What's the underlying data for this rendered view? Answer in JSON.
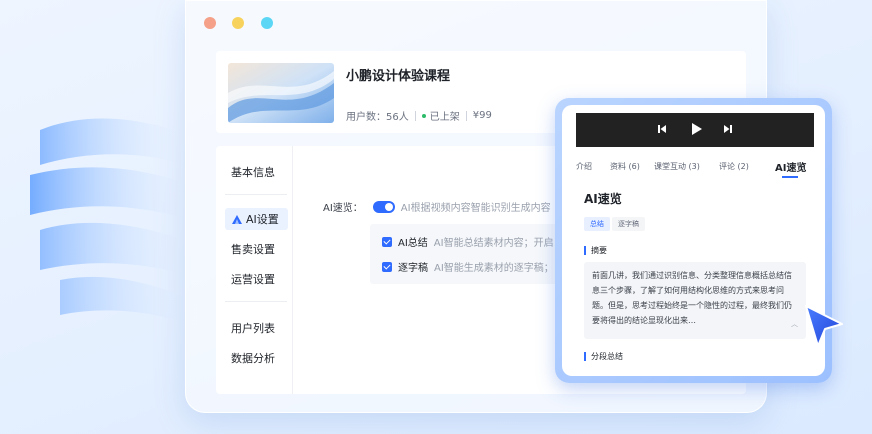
{
  "course": {
    "title": "小鹏设计体验课程",
    "users": "用户数：56人",
    "status": "已上架",
    "price": "¥99"
  },
  "sidebar": {
    "items": [
      "基本信息",
      "AI设置",
      "售卖设置",
      "运营设置",
      "用户列表",
      "数据分析"
    ],
    "active_index": 1
  },
  "ai_settings": {
    "label": "AI速览：",
    "toggle_on": true,
    "hint": "AI根据视频内容智能识别生成内容",
    "options": [
      {
        "label": "AI总结",
        "hint": "AI智能总结素材内容；开启",
        "checked": true
      },
      {
        "label": "逐字稿",
        "hint": "AI智能生成素材的逐字稿；",
        "checked": true
      }
    ]
  },
  "preview": {
    "tabs": [
      "介绍",
      "资料 (6)",
      "课堂互动 (3)",
      "评论 (2)",
      "AI速览"
    ],
    "active_tab": "AI速览",
    "section_title": "AI速览",
    "subtabs": [
      "总结",
      "逐字稿"
    ],
    "summary_heading": "摘要",
    "summary_text": "前面几讲，我们通过识别信息、分类整理信息概括总结信息三个步骤，了解了如何用结构化思维的方式来思考问题。但是，思考过程始终是一个隐性的过程，最终我们仍要将得出的结论显现化出来…",
    "segments_heading": "分段总结"
  },
  "colors": {
    "accent": "#2f6bff",
    "status_green": "#2dbb6a",
    "player_bg": "#222222"
  },
  "icons": {
    "prev": "skip-previous-icon",
    "play": "play-icon",
    "next": "skip-next-icon",
    "ai": "ai-triangle-icon",
    "cursor": "pointer-arrow-icon"
  }
}
